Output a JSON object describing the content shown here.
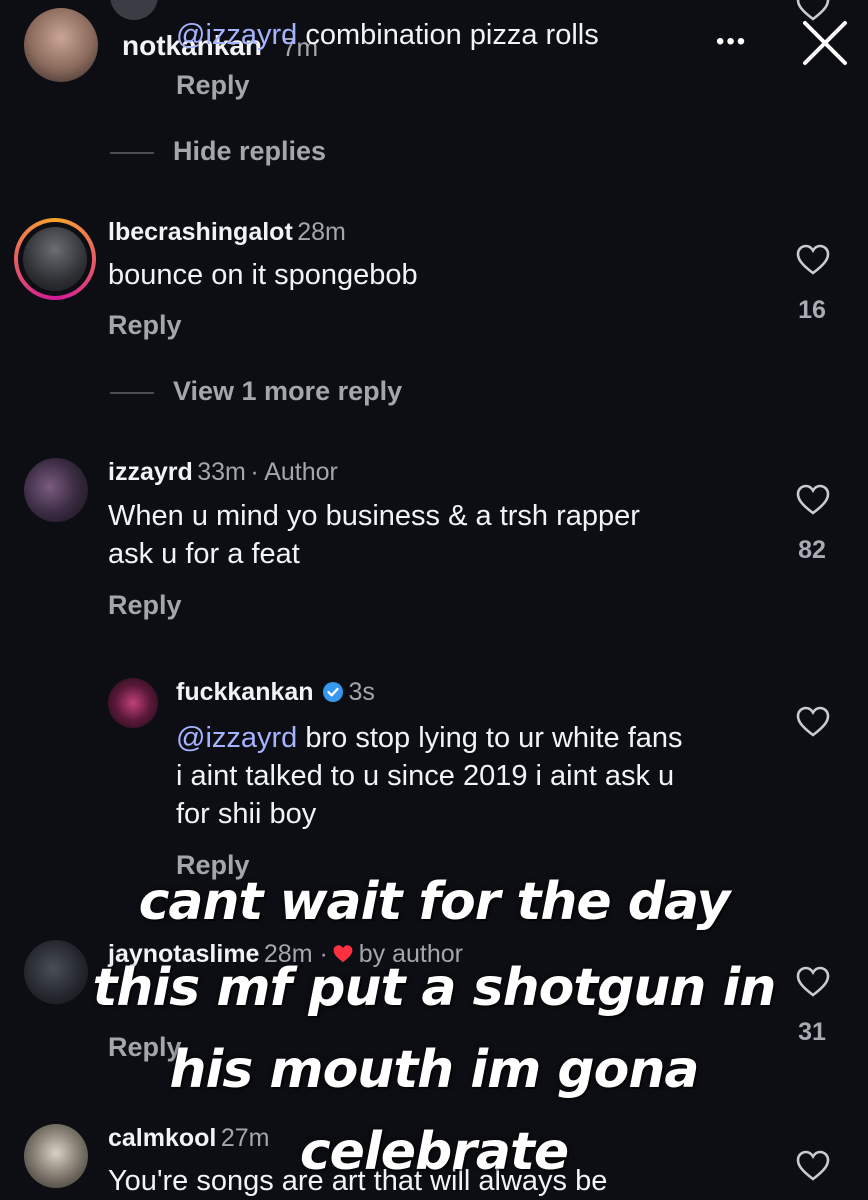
{
  "story": {
    "username": "notkankan",
    "time": "7m",
    "more": "•••",
    "close": "✕"
  },
  "comments": {
    "top_partial": {
      "mention": "@izzayrd",
      "text": " combination pizza rolls",
      "reply": "Reply"
    },
    "hide_replies": "Hide replies",
    "c1": {
      "username": "lbecrashingalot",
      "time": "28m",
      "text": "bounce on it spongebob",
      "reply": "Reply",
      "likes": "16",
      "view_more": "View 1 more reply"
    },
    "c2": {
      "username": "izzayrd",
      "time": "33m",
      "author_tag": "· Author",
      "line1": "When u mind yo business & a trsh  rapper",
      "line2": "ask u for a feat",
      "reply": "Reply",
      "likes": "82"
    },
    "c3": {
      "username": "fuckkankan",
      "time": "3s",
      "mention": "@izzayrd",
      "line1": " bro stop lying to ur white fans",
      "line2": "i aint talked to u since 2019 i aint ask u",
      "line3": "for shii boy",
      "reply": "Reply"
    },
    "c4": {
      "username": "jaynotaslime",
      "time": "28m ·",
      "by_author": "by author",
      "reply": "Reply",
      "likes": "31"
    },
    "c5": {
      "username": "calmkool",
      "time": "27m",
      "text": "You're songs are art that will always be"
    }
  },
  "overlay": {
    "line1": "cant wait for the day",
    "line2": "this mf put a shotgun in",
    "line3": "his mouth im gona",
    "line4": "celebrate"
  },
  "colors": {
    "background": "#0c0e13",
    "mention": "#a6b3ff",
    "verified": "#3897f0",
    "story_ring_start": "#f9a42b",
    "story_ring_end": "#d3199a",
    "heart_red": "#ff3040"
  }
}
